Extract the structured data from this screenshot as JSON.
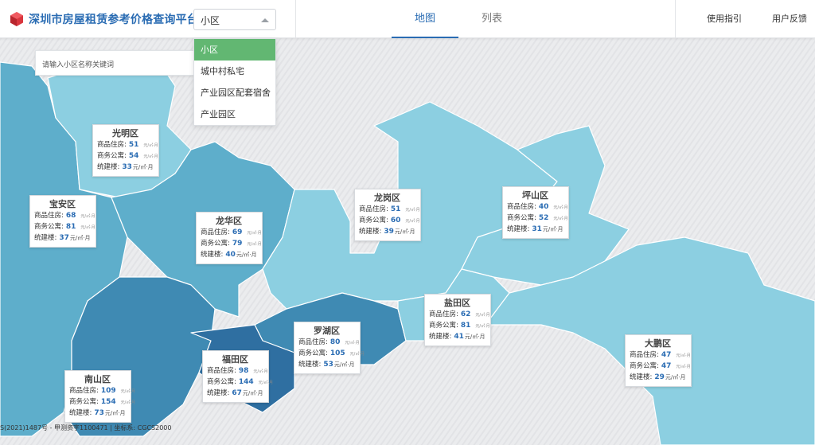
{
  "header": {
    "title": "深圳市房屋租赁参考价格查询平台",
    "select_value": "小区",
    "tabs": [
      {
        "label": "地图",
        "active": true
      },
      {
        "label": "列表",
        "active": false
      }
    ],
    "links": [
      "使用指引",
      "用户反馈"
    ]
  },
  "dropdown": {
    "options": [
      "小区",
      "城中村私宅",
      "产业园区配套宿舍",
      "产业园区"
    ],
    "selected_index": 0
  },
  "search": {
    "placeholder": "请输入小区名称关键词"
  },
  "labels": {
    "residential": "商品住房:",
    "commercial": "商务公寓:",
    "unified": "统建楼:",
    "unit": "元/㎡·月"
  },
  "districts": [
    {
      "name": "光明区",
      "residential": "51",
      "commercial": "54",
      "unified": "33"
    },
    {
      "name": "宝安区",
      "residential": "68",
      "commercial": "81",
      "unified": "37"
    },
    {
      "name": "龙华区",
      "residential": "69",
      "commercial": "79",
      "unified": "40"
    },
    {
      "name": "龙岗区",
      "residential": "51",
      "commercial": "60",
      "unified": "39"
    },
    {
      "name": "坪山区",
      "residential": "40",
      "commercial": "52",
      "unified": "31"
    },
    {
      "name": "盐田区",
      "residential": "62",
      "commercial": "81",
      "unified": "41"
    },
    {
      "name": "罗湖区",
      "residential": "80",
      "commercial": "105",
      "unified": "53"
    },
    {
      "name": "福田区",
      "residential": "98",
      "commercial": "144",
      "unified": "67"
    },
    {
      "name": "南山区",
      "residential": "109",
      "commercial": "154",
      "unified": "73"
    },
    {
      "name": "大鹏区",
      "residential": "47",
      "commercial": "47",
      "unified": "29"
    }
  ],
  "footer": "S(2021)1487号 - 甲测资字1100471 | 坐标系: CGCS2000",
  "colors": {
    "brand": "#2a6cb3",
    "selected_option": "#62b772",
    "map_light": "#8ccfe1",
    "map_mid": "#5eaecb",
    "map_dark": "#3f8ab3",
    "map_darkest": "#2f6fa1"
  }
}
